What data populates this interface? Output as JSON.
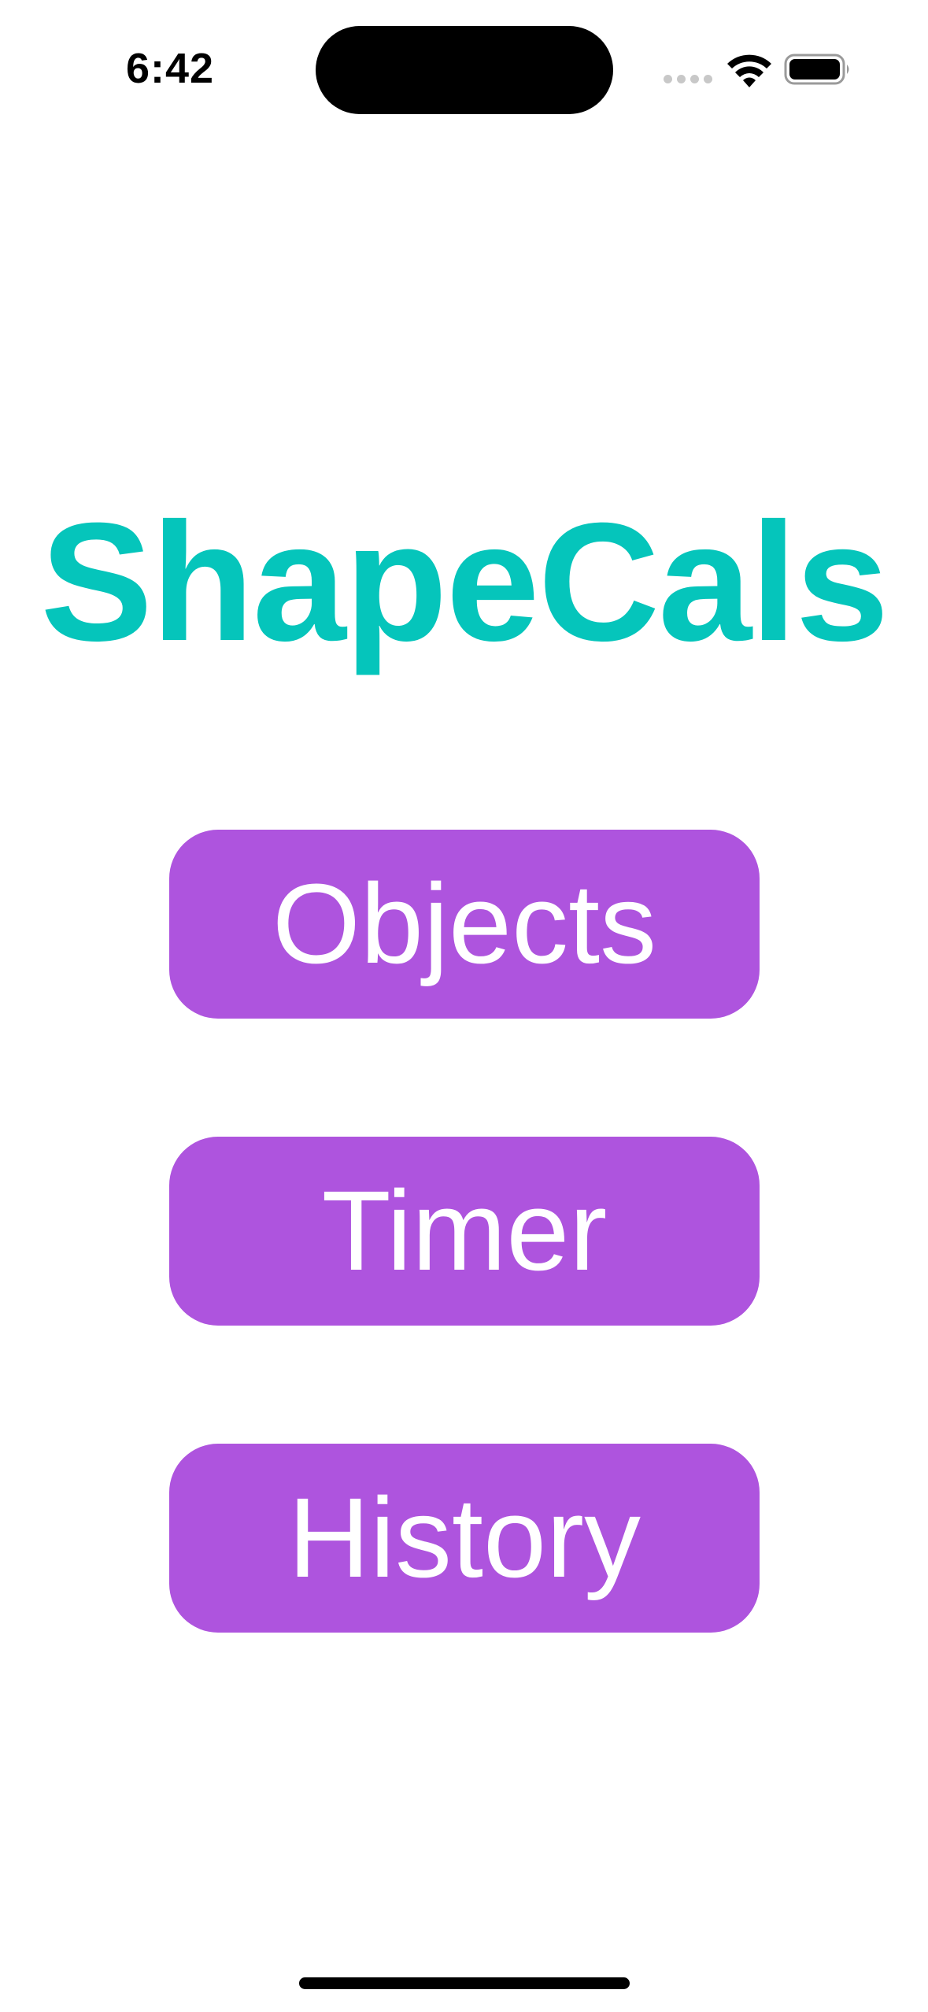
{
  "status_bar": {
    "time": "6:42",
    "icons": [
      "cellular-signal-icon",
      "wifi-icon",
      "battery-icon"
    ]
  },
  "app": {
    "title": "ShapeCals",
    "title_color": "#05c5bb"
  },
  "menu": {
    "button_color": "#ae54de",
    "buttons": [
      {
        "label": "Objects"
      },
      {
        "label": "Timer"
      },
      {
        "label": "History"
      }
    ]
  }
}
